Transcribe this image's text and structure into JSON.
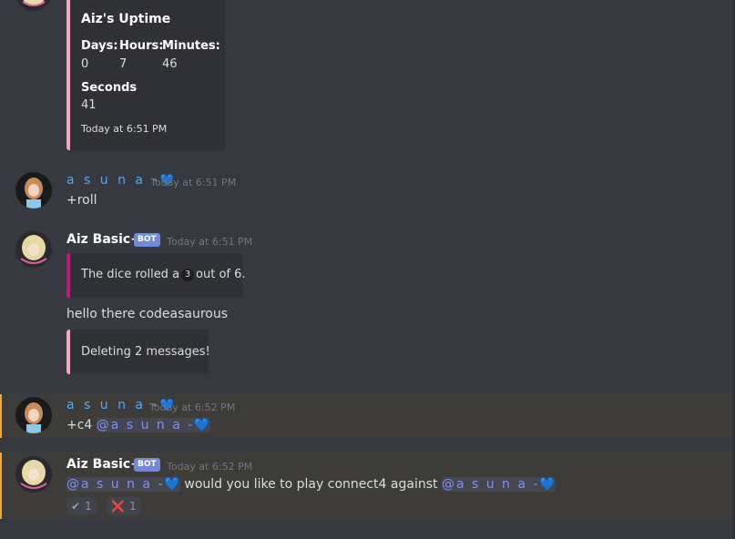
{
  "uptime_embed": {
    "title": "Aiz's Uptime",
    "fields": [
      {
        "name": "Days:",
        "value": "0"
      },
      {
        "name": "Hours:",
        "value": "7"
      },
      {
        "name": "Minutes:",
        "value": "46"
      },
      {
        "name": "Seconds",
        "value": "41"
      }
    ],
    "footer": "Today at 6:51 PM"
  },
  "messages": [
    {
      "author": "a s u n a -",
      "heart": "💙",
      "timestamp": "Today at 6:51 PM",
      "text": "+roll"
    },
    {
      "author": "Aiz Basic+",
      "badge": "BOT",
      "timestamp": "Today at 6:51 PM",
      "embed_prefix": "The dice rolled a",
      "dice_value": "3",
      "embed_suffix": "out of 6.",
      "text2": "hello there codeasaurous",
      "embed2": "Deleting 2 messages!"
    },
    {
      "author": "a s u n a -",
      "heart": "💙",
      "timestamp": "Today at 6:52 PM",
      "text_prefix": "+c4",
      "mention": "@a s u n a -",
      "mention_heart": "💙"
    },
    {
      "author": "Aiz Basic+",
      "badge": "BOT",
      "timestamp": "Today at 6:52 PM",
      "mention1": "@a s u n a -",
      "mention1_heart": "💙",
      "middle_text": "would you like to play connect4 against",
      "mention2": "@a s u n a -",
      "mention2_heart": "💙",
      "reactions": [
        {
          "emoji": "✔",
          "count": "1"
        },
        {
          "emoji": "❌",
          "count": "1"
        }
      ]
    }
  ],
  "colors": {
    "background": "#36393f",
    "embed_bg": "#2f3136",
    "embed_pink_border": "#f5a8ba",
    "embed_magenta_border": "#c2187e",
    "mention_color": "#7f8ff7",
    "highlight_border": "#faa61a",
    "bot_badge": "#7289da"
  }
}
